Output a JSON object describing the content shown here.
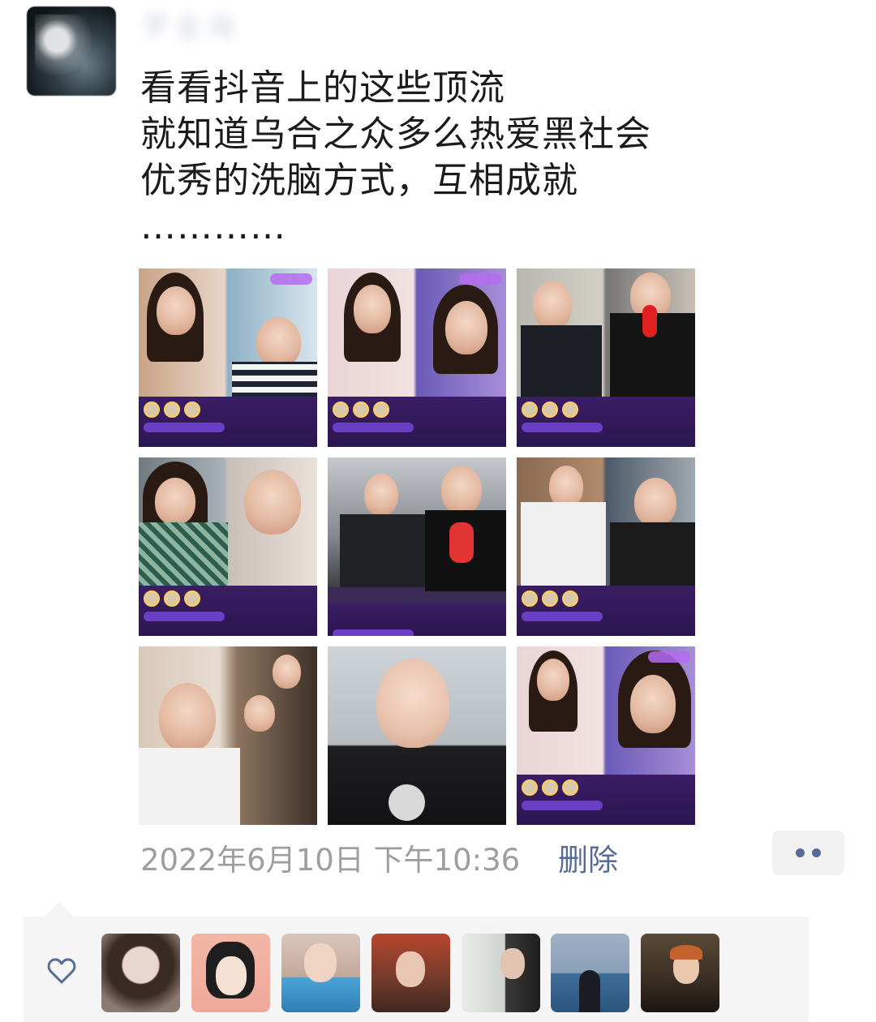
{
  "post": {
    "author_name": "罗金海",
    "text_lines": [
      "看看抖音上的这些顶流",
      "就知道乌合之众多么热爱黑社会",
      "优秀的洗脑方式，互相成就",
      "…………"
    ],
    "timestamp": "2022年6月10日 下午10:36",
    "delete_label": "删除"
  },
  "images": [
    {
      "id": "1",
      "description": "live stream screenshot"
    },
    {
      "id": "2",
      "description": "live stream screenshot"
    },
    {
      "id": "3",
      "description": "live stream screenshot"
    },
    {
      "id": "4",
      "description": "live stream screenshot"
    },
    {
      "id": "5",
      "description": "live stream screenshot"
    },
    {
      "id": "6",
      "description": "live stream screenshot"
    },
    {
      "id": "7",
      "description": "live stream screenshot"
    },
    {
      "id": "8",
      "description": "live stream screenshot"
    },
    {
      "id": "9",
      "description": "live stream screenshot"
    }
  ],
  "likes": {
    "icon": "heart-outline-icon",
    "count_shown": 7
  },
  "colors": {
    "link": "#576b95",
    "timestamp": "#9e9e9e",
    "likes_bg": "#f5f5f5"
  }
}
